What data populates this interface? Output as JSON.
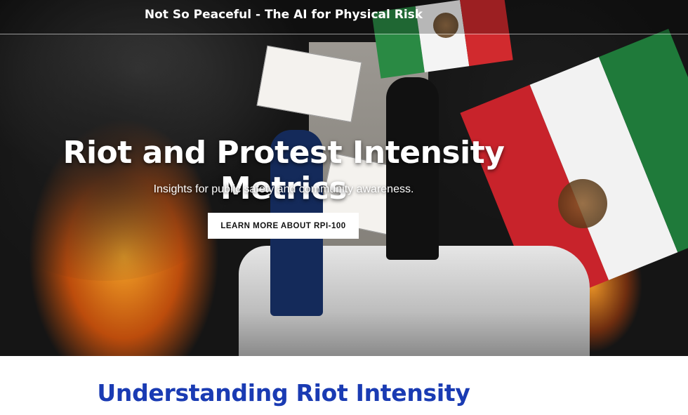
{
  "header": {
    "site_title": "Not So Peaceful - The AI for Physical Risk"
  },
  "hero": {
    "heading": "Riot and Protest Intensity Metrics",
    "subheading": "Insights for public safety and community awareness.",
    "cta_label": "LEARN MORE ABOUT RPI-100"
  },
  "section": {
    "heading": "Understanding Riot Intensity"
  },
  "colors": {
    "heading_blue": "#1a3bb3",
    "cta_background": "#ffffff",
    "hero_text": "#ffffff"
  }
}
